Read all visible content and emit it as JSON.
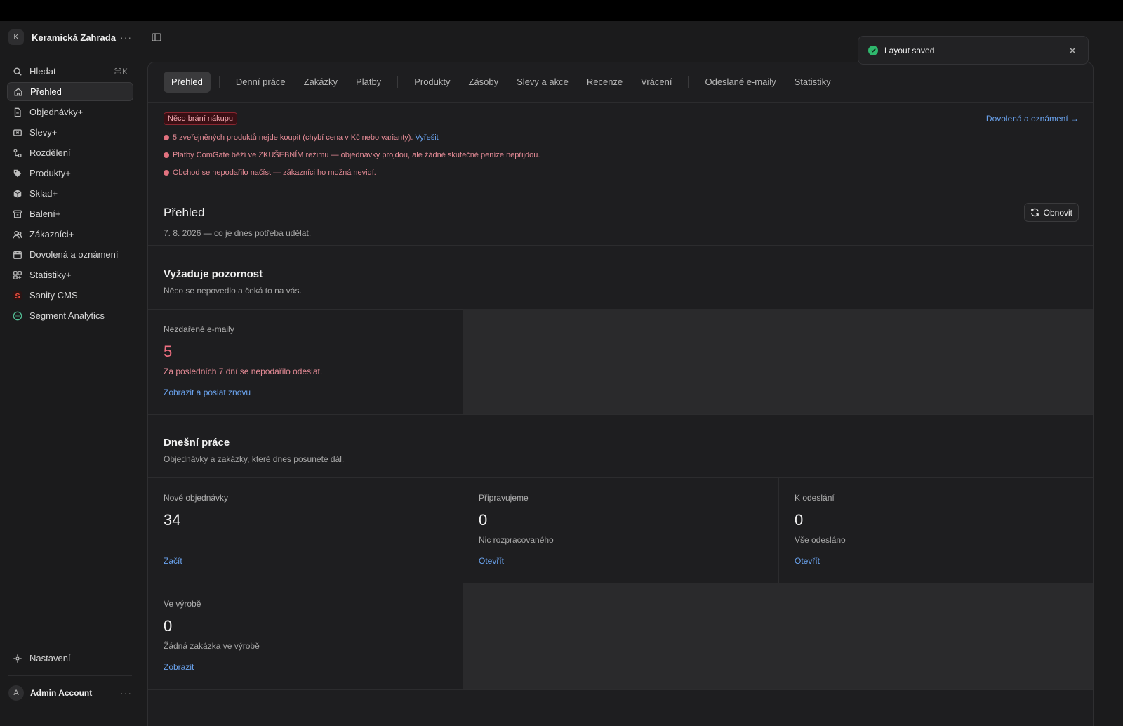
{
  "store": {
    "initial": "K",
    "name": "Keramická Zahrada"
  },
  "sidebar": {
    "search": {
      "label": "Hledat",
      "shortcut": "⌘K"
    },
    "items": [
      {
        "label": "Přehled",
        "icon": "home-icon"
      },
      {
        "label": "Objednávky+",
        "icon": "file-icon"
      },
      {
        "label": "Slevy+",
        "icon": "ticket-icon"
      },
      {
        "label": "Rozdělení",
        "icon": "split-icon"
      },
      {
        "label": "Produkty+",
        "icon": "tag-icon"
      },
      {
        "label": "Sklad+",
        "icon": "box-icon"
      },
      {
        "label": "Balení+",
        "icon": "archive-icon"
      },
      {
        "label": "Zákazníci+",
        "icon": "users-icon"
      },
      {
        "label": "Dovolená a oznámení",
        "icon": "calendar-icon"
      },
      {
        "label": "Statistiky+",
        "icon": "grid-icon"
      },
      {
        "label": "Sanity CMS",
        "icon": "sanity-logo-icon"
      },
      {
        "label": "Segment Analytics",
        "icon": "segment-logo-icon"
      }
    ],
    "settings": "Nastavení"
  },
  "account": {
    "initial": "A",
    "name": "Admin Account"
  },
  "toast": {
    "text": "Layout saved"
  },
  "tabs": [
    "Přehled",
    "Denní práce",
    "Zakázky",
    "Platby",
    "Produkty",
    "Zásoby",
    "Slevy a akce",
    "Recenze",
    "Vrácení",
    "Odeslané e-maily",
    "Statistiky"
  ],
  "alert": {
    "badge": "Něco brání nákupu",
    "lines": [
      "5 zveřejněných produktů nejde koupit (chybí cena v Kč nebo varianty).",
      "Platby ComGate běží ve ZKUŠEBNÍM režimu — objednávky projdou, ale žádné skutečné peníze nepřijdou.",
      "Obchod se nepodařilo načíst — zákazníci ho možná nevidí."
    ],
    "fix_link": "Vyřešit",
    "right_link": "Dovolená a oznámení →"
  },
  "overview": {
    "title": "Přehled",
    "subtitle": "7. 8. 2026 — co je dnes potřeba udělat.",
    "refresh": "Obnovit"
  },
  "attention": {
    "title": "Vyžaduje pozornost",
    "subtitle": "Něco se nepovedlo a čeká to na vás.",
    "card": {
      "label": "Nezdařené e-maily",
      "value": "5",
      "note": "Za posledních 7 dní se nepodařilo odeslat.",
      "link": "Zobrazit a poslat znovu"
    }
  },
  "today": {
    "title": "Dnešní práce",
    "subtitle": "Objednávky a zakázky, které dnes posunete dál.",
    "cards": [
      {
        "label": "Nové objednávky",
        "value": "34",
        "note": "",
        "link": "Začít"
      },
      {
        "label": "Připravujeme",
        "value": "0",
        "note": "Nic rozpracovaného",
        "link": "Otevřít"
      },
      {
        "label": "K odeslání",
        "value": "0",
        "note": "Vše odesláno",
        "link": "Otevřít"
      },
      {
        "label": "Ve výrobě",
        "value": "0",
        "note": "Žádná zakázka ve výrobě",
        "link": "Zobrazit"
      }
    ]
  }
}
